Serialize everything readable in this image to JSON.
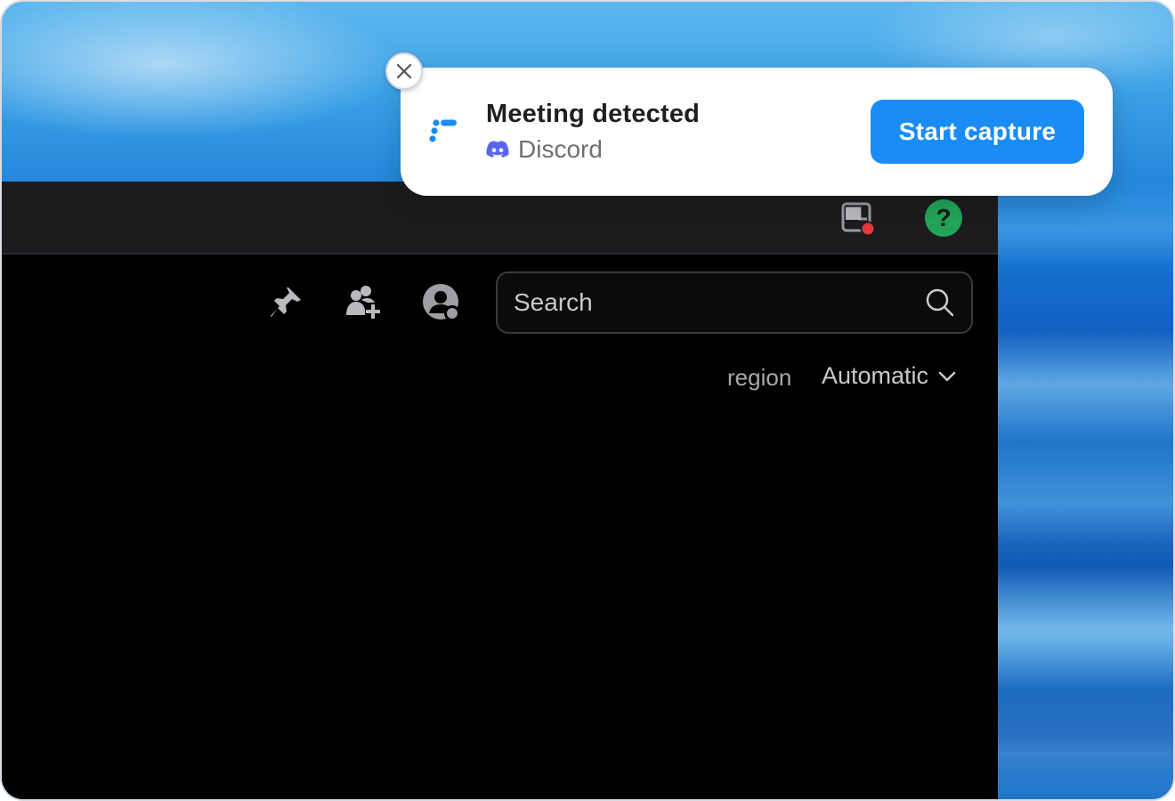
{
  "notification": {
    "title": "Meeting detected",
    "app_name": "Discord",
    "app_icon": "discord-icon",
    "logo_icon": "capture-app-logo-icon",
    "close_icon": "close-icon",
    "action_label": "Start capture",
    "accent_color": "#1a8cf5"
  },
  "titlebar": {
    "inbox_icon": "inbox-icon",
    "inbox_badge_color": "#e5383b",
    "help_label": "?",
    "help_color": "#23a559"
  },
  "toolbar": {
    "icons": [
      "pin-icon",
      "add-member-icon",
      "user-profile-icon"
    ],
    "search": {
      "placeholder": "Search",
      "value": ""
    }
  },
  "voice": {
    "region_label": "region",
    "region_value": "Automatic"
  }
}
